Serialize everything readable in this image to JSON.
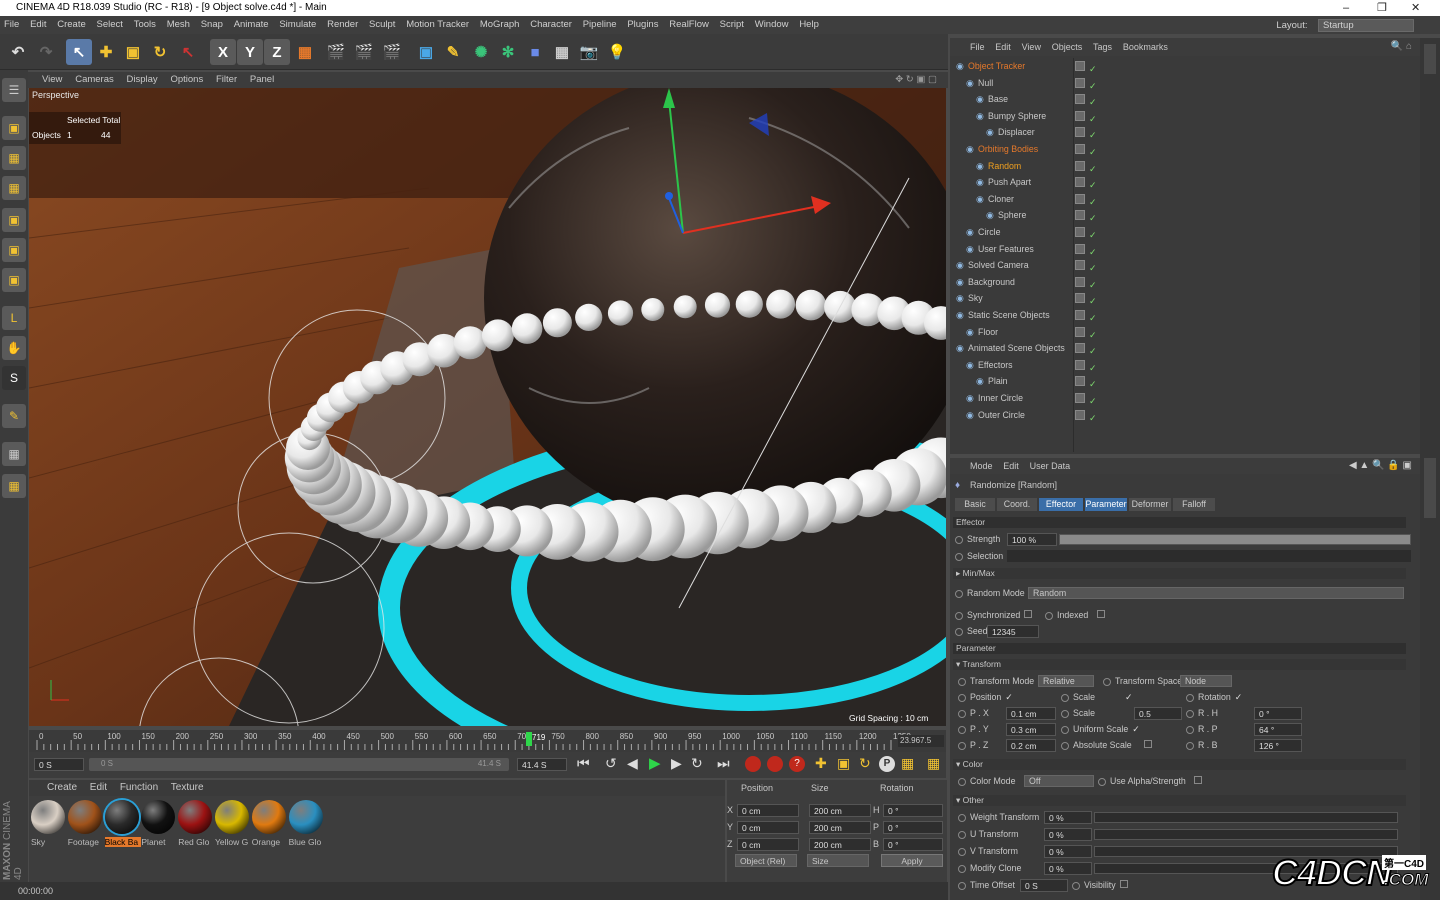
{
  "window": {
    "title": "CINEMA 4D R18.039 Studio (RC - R18) - [9 Object solve.c4d *] - Main"
  },
  "menubar": {
    "items": [
      "File",
      "Edit",
      "Create",
      "Select",
      "Tools",
      "Mesh",
      "Snap",
      "Animate",
      "Simulate",
      "Render",
      "Sculpt",
      "Motion Tracker",
      "MoGraph",
      "Character",
      "Pipeline",
      "Plugins",
      "RealFlow",
      "Script",
      "Window",
      "Help"
    ],
    "layout_label": "Layout:",
    "layout_value": "Startup"
  },
  "viewport": {
    "menu": [
      "View",
      "Cameras",
      "Display",
      "Options",
      "Filter",
      "Panel"
    ],
    "label": "Perspective",
    "stats_header": "Selected Total",
    "stats_label": "Objects",
    "stats_selected": "1",
    "stats_total": "44",
    "grid_spacing": "Grid Spacing : 10 cm"
  },
  "timeline": {
    "ticks": [
      "0",
      "50",
      "100",
      "150",
      "200",
      "250",
      "300",
      "350",
      "400",
      "450",
      "500",
      "550",
      "600",
      "650",
      "700",
      "750",
      "800",
      "850",
      "900",
      "950",
      "1000",
      "1050",
      "1100",
      "1150",
      "1200",
      "1250"
    ],
    "playhead": "719",
    "end_value": "23.967.5",
    "start_field": "0 S",
    "range_start": "0 S",
    "range_end": "41.4 S",
    "end_field": "41.4 S"
  },
  "materials": {
    "menu": [
      "Create",
      "Edit",
      "Function",
      "Texture"
    ],
    "items": [
      {
        "label": "Sky",
        "color": "#d9cfc4"
      },
      {
        "label": "Footage",
        "color": "#a0521a"
      },
      {
        "label": "Black Ba",
        "color": "#2a2a2a",
        "selected": true
      },
      {
        "label": "Planet",
        "color": "#111111"
      },
      {
        "label": "Red Glo",
        "color": "#9c1212"
      },
      {
        "label": "Yellow G",
        "color": "#d8b800"
      },
      {
        "label": "Orange",
        "color": "#e07a10"
      },
      {
        "label": "Blue Glo",
        "color": "#2a8fc0"
      }
    ]
  },
  "coords": {
    "headers": [
      "Position",
      "Size",
      "Rotation"
    ],
    "rows": [
      {
        "axis": "X",
        "pos": "0 cm",
        "size": "200 cm",
        "rot_axis": "H",
        "rot": "0 °"
      },
      {
        "axis": "Y",
        "pos": "0 cm",
        "size": "200 cm",
        "rot_axis": "P",
        "rot": "0 °"
      },
      {
        "axis": "Z",
        "pos": "0 cm",
        "size": "200 cm",
        "rot_axis": "B",
        "rot": "0 °"
      }
    ],
    "mode": "Object (Rel)",
    "size_mode": "Size",
    "apply": "Apply"
  },
  "status": {
    "time": "00:00:00"
  },
  "object_manager": {
    "menu": [
      "File",
      "Edit",
      "View",
      "Objects",
      "Tags",
      "Bookmarks"
    ],
    "objects": [
      {
        "name": "Object Tracker",
        "depth": 0,
        "color": "#e6792b"
      },
      {
        "name": "Null",
        "depth": 1,
        "color": "#c8c8c8"
      },
      {
        "name": "Base",
        "depth": 2,
        "color": "#c8c8c8"
      },
      {
        "name": "Bumpy Sphere",
        "depth": 2,
        "color": "#c8c8c8"
      },
      {
        "name": "Displacer",
        "depth": 3,
        "color": "#c8c8c8"
      },
      {
        "name": "Orbiting Bodies",
        "depth": 1,
        "color": "#e6792b"
      },
      {
        "name": "Random",
        "depth": 2,
        "color": "#f0a020"
      },
      {
        "name": "Push Apart",
        "depth": 2,
        "color": "#c8c8c8"
      },
      {
        "name": "Cloner",
        "depth": 2,
        "color": "#c8c8c8"
      },
      {
        "name": "Sphere",
        "depth": 3,
        "color": "#c8c8c8"
      },
      {
        "name": "Circle",
        "depth": 1,
        "color": "#c8c8c8"
      },
      {
        "name": "User Features",
        "depth": 1,
        "color": "#c8c8c8"
      },
      {
        "name": "Solved Camera",
        "depth": 0,
        "color": "#c8c8c8"
      },
      {
        "name": "Background",
        "depth": 0,
        "color": "#c8c8c8"
      },
      {
        "name": "Sky",
        "depth": 0,
        "color": "#c8c8c8"
      },
      {
        "name": "Static Scene Objects",
        "depth": 0,
        "color": "#c8c8c8"
      },
      {
        "name": "Floor",
        "depth": 1,
        "color": "#c8c8c8"
      },
      {
        "name": "Animated Scene Objects",
        "depth": 0,
        "color": "#c8c8c8"
      },
      {
        "name": "Effectors",
        "depth": 1,
        "color": "#c8c8c8"
      },
      {
        "name": "Plain",
        "depth": 2,
        "color": "#c8c8c8"
      },
      {
        "name": "Inner Circle",
        "depth": 1,
        "color": "#c8c8c8"
      },
      {
        "name": "Outer Circle",
        "depth": 1,
        "color": "#c8c8c8"
      }
    ]
  },
  "attributes": {
    "menu": [
      "Mode",
      "Edit",
      "User Data"
    ],
    "object_title": "Randomize [Random]",
    "tabs": [
      "Basic",
      "Coord.",
      "Effector",
      "Parameter",
      "Deformer",
      "Falloff"
    ],
    "effector_header": "Effector",
    "strength_label": "Strength",
    "strength_value": "100 %",
    "strength_fraction": 1.0,
    "selection_label": "Selection",
    "minmax_label": "Min/Max",
    "random_mode_label": "Random Mode",
    "random_mode_value": "Random",
    "synchronized_label": "Synchronized",
    "indexed_label": "Indexed",
    "seed_label": "Seed",
    "seed_value": "12345",
    "parameter_header": "Parameter",
    "transform_header": "Transform",
    "transform_mode_label": "Transform Mode",
    "transform_mode_value": "Relative",
    "transform_space_label": "Transform Space",
    "transform_space_value": "Node",
    "position_label": "Position",
    "scale_label": "Scale",
    "rotation_label": "Rotation",
    "px_label": "P . X",
    "px_value": "0.1 cm",
    "py_label": "P . Y",
    "py_value": "0.3 cm",
    "pz_label": "P . Z",
    "pz_value": "0.2 cm",
    "scale_field_label": "Scale",
    "scale_value": "0.5",
    "uniform_scale_label": "Uniform Scale",
    "absolute_scale_label": "Absolute Scale",
    "rh_label": "R . H",
    "rh_value": "0 °",
    "rp_label": "R . P",
    "rp_value": "64 °",
    "rb_label": "R . B",
    "rb_value": "126 °",
    "color_header": "Color",
    "color_mode_label": "Color Mode",
    "color_mode_value": "Off",
    "use_alpha_label": "Use Alpha/Strength",
    "other_header": "Other",
    "weight_label": "Weight Transform",
    "weight_value": "0 %",
    "utrans_label": "U Transform",
    "utrans_value": "0 %",
    "vtrans_label": "V Transform",
    "vtrans_value": "0 %",
    "modclone_label": "Modify Clone",
    "modclone_value": "0 %",
    "timeoffset_label": "Time Offset",
    "timeoffset_value": "0 S",
    "visibility_label": "Visibility"
  },
  "watermark": {
    "brand": "C4DCN",
    "sub": "第一C4D",
    "domain": ".COM",
    "maxon": "MAXON",
    "c4d": "CINEMA 4D"
  }
}
